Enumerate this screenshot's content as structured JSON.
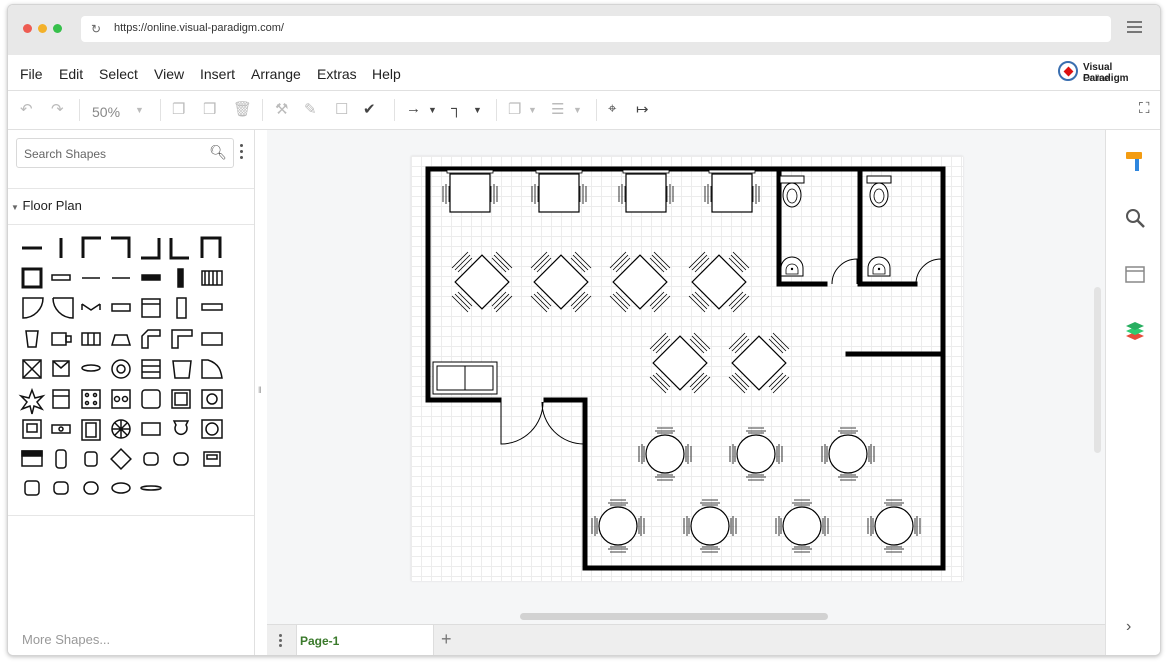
{
  "browser": {
    "url": "https://online.visual-paradigm.com/",
    "dots": [
      "#ee5c52",
      "#f3b12a",
      "#36c04b"
    ]
  },
  "menu": {
    "items": [
      "File",
      "Edit",
      "Select",
      "View",
      "Insert",
      "Arrange",
      "Extras",
      "Help"
    ]
  },
  "logo": {
    "line1": "Visual Paradigm",
    "line2": "Online"
  },
  "toolbar": {
    "zoom": "50%"
  },
  "sidebar": {
    "search_placeholder": "Search Shapes",
    "category": "Floor Plan",
    "more_shapes": "More Shapes..."
  },
  "pages": {
    "active_tab": "Page-1",
    "add_label": "+"
  },
  "right_panel": {
    "icons": [
      "format-icon",
      "search-icon",
      "outline-icon",
      "layers-icon"
    ]
  },
  "colors": {
    "accent_green": "#3b7a2c",
    "wall": "#000000",
    "format_orange": "#f39c12",
    "format_blue": "#2e86de"
  }
}
